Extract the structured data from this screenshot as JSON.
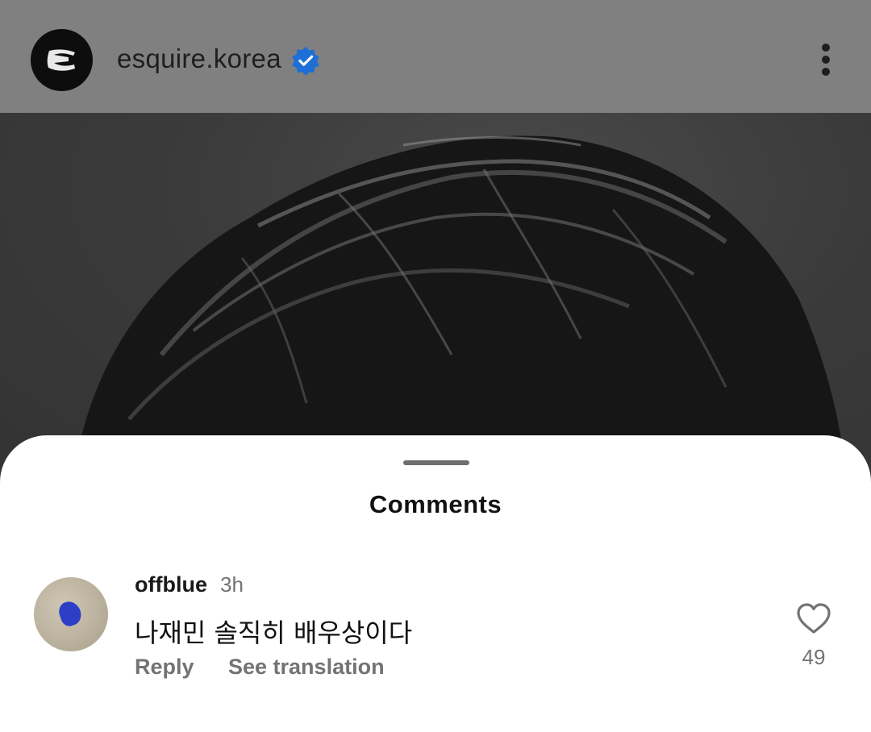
{
  "header": {
    "account_name": "esquire.korea",
    "verified_icon": "verified-badge-icon",
    "more_icon": "more-vertical-icon"
  },
  "sheet": {
    "title": "Comments"
  },
  "comments": [
    {
      "username": "offblue",
      "time": "3h",
      "text": "나재민 솔직히 배우상이다",
      "reply_label": "Reply",
      "translate_label": "See translation",
      "like_icon": "heart-outline-icon",
      "like_count": "49"
    }
  ],
  "colors": {
    "header_overlay": "#808080",
    "verified_blue": "#1d6fd6",
    "secondary_text": "#737373"
  }
}
